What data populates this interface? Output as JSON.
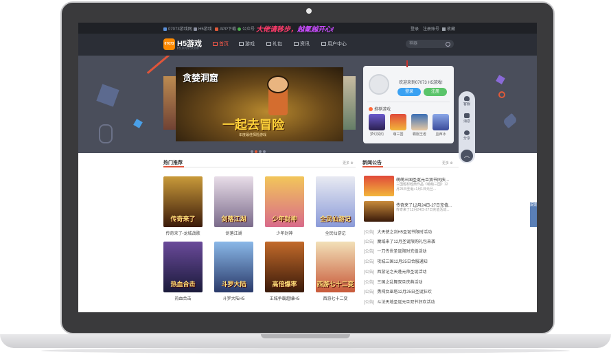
{
  "topbar": {
    "links": [
      "07073游戏网",
      "H5游戏",
      "APP下载",
      "公众号"
    ],
    "promo_a": "大佬请移步，",
    "promo_b": "越氪越开心!",
    "right": [
      "登录",
      "注册账号",
      "收藏"
    ]
  },
  "nav": {
    "logo_text": "H5游戏",
    "logo_mark": "07073",
    "logo_sub": "h5.07073.com",
    "items": [
      "首页",
      "游戏",
      "礼包",
      "资讯",
      "用户中心"
    ],
    "search_placeholder": "神器"
  },
  "banner": {
    "slide_title": "贪婪洞窟",
    "slide_big": "一起去冒险",
    "slide_sub": "年度最佳探险游戏"
  },
  "login_card": {
    "welcome": "欢迎来到07073 H5游戏!",
    "login": "登录",
    "register": "注册",
    "rec_title": "推荐游戏",
    "rec_games": [
      {
        "name": "梦幻契约",
        "color": "#6a5acd"
      },
      {
        "name": "萌三国",
        "color": "#e04a3a"
      },
      {
        "name": "霸服王者",
        "color": "#3a6fb6"
      },
      {
        "name": "血西冰",
        "color": "#8aa7e8"
      }
    ]
  },
  "float": {
    "items": [
      "客服",
      "消息",
      "分享"
    ],
    "up": "︿"
  },
  "edge_tab": "反馈",
  "hot": {
    "title": "热门推荐",
    "more": "更多 ⊕",
    "games": [
      {
        "name": "传奇来了-龙城战歌",
        "cover": "传奇来了",
        "color": "#7a3a1a"
      },
      {
        "name": "剑落江湖",
        "cover": "剑落江湖",
        "color": "#b7a2b8"
      },
      {
        "name": "少年封神",
        "cover": "少年封神",
        "color": "#d9a34a"
      },
      {
        "name": "全民仙游记",
        "cover": "全民仙游记",
        "color": "#9fb7d8"
      },
      {
        "name": "热血合击",
        "cover": "热血合击",
        "color": "#3a2a5a"
      },
      {
        "name": "斗罗大陆H5",
        "cover": "斗罗大陆",
        "color": "#3a6aa8"
      },
      {
        "name": "王城争霸超爆H5",
        "cover": "高倍爆率",
        "color": "#6a2a1a"
      },
      {
        "name": "西游七十二变",
        "cover": "西游七十二变",
        "color": "#c88a3a"
      }
    ]
  },
  "news": {
    "title": "新闻公告",
    "more": "更多 ⊕",
    "featured": [
      {
        "title": "萌萌三国圣诞元旦双节同庆...",
        "desc": "三国题材经典作品《萌萌三国》12月25日圣诞+1月1日元旦...",
        "color": "#c23b2a"
      },
      {
        "title": "传奇来了12月24日-27日充值...",
        "desc": "传奇来了12月24日-27日充值活动...",
        "color": "#a3622a"
      }
    ],
    "items": [
      {
        "cat": "[公告]",
        "text": "大天使之剑H5圣诞节限时活动"
      },
      {
        "cat": "[公告]",
        "text": "魔域来了12月圣诞限购礼包来袭"
      },
      {
        "cat": "[公告]",
        "text": "一刀传世圣诞限时充值活动"
      },
      {
        "cat": "[公告]",
        "text": "攻城三国12月25日合服通知"
      },
      {
        "cat": "[公告]",
        "text": "西游记之天蓬元帅圣诞活动"
      },
      {
        "cat": "[公告]",
        "text": "三国之乱舞双旦庆典活动"
      },
      {
        "cat": "[公告]",
        "text": "勇闯女巫塔12月25日圣诞狂欢"
      },
      {
        "cat": "[公告]",
        "text": "斗法天地圣诞元旦双节狂欢活动"
      }
    ]
  }
}
